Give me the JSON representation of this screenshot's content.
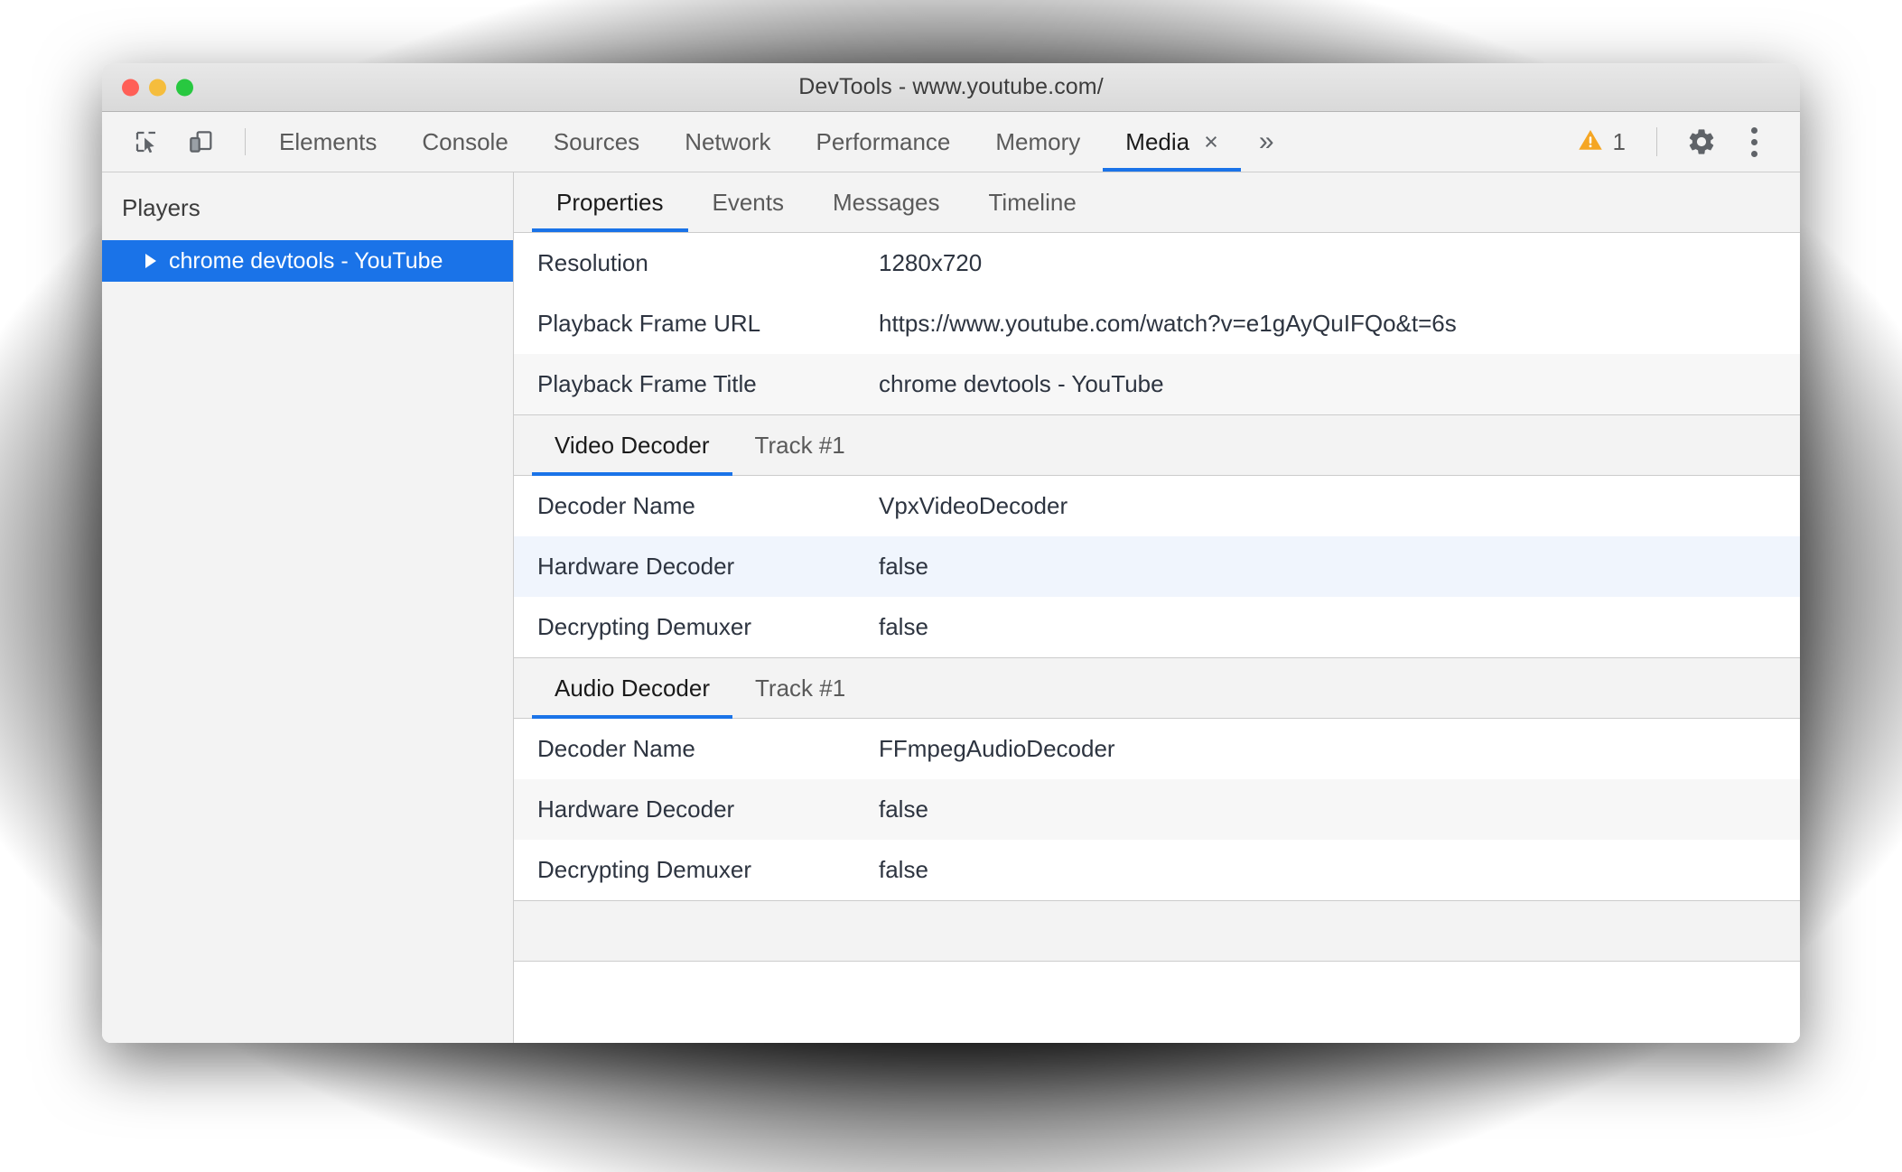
{
  "window": {
    "title": "DevTools - www.youtube.com/",
    "traffic_lights": [
      "close-red",
      "minimize-yellow",
      "zoom-green"
    ]
  },
  "toolbar": {
    "inspect_icon": "inspect-element-icon",
    "device_icon": "device-toolbar-icon",
    "tabs": [
      {
        "label": "Elements",
        "active": false,
        "closable": false
      },
      {
        "label": "Console",
        "active": false,
        "closable": false
      },
      {
        "label": "Sources",
        "active": false,
        "closable": false
      },
      {
        "label": "Network",
        "active": false,
        "closable": false
      },
      {
        "label": "Performance",
        "active": false,
        "closable": false
      },
      {
        "label": "Memory",
        "active": false,
        "closable": false
      },
      {
        "label": "Media",
        "active": true,
        "closable": true
      }
    ],
    "close_glyph": "×",
    "overflow_glyph": "»",
    "warning_count": "1",
    "warning_icon": "warning-triangle-icon",
    "settings_icon": "gear-icon",
    "more_icon": "kebab-menu-icon",
    "accent_color": "#1a73e8",
    "warning_color": "#f5a623"
  },
  "sidebar": {
    "title": "Players",
    "players": [
      {
        "label": "chrome devtools - YouTube",
        "selected": true,
        "expand_glyph": "▶"
      }
    ]
  },
  "panel": {
    "subtabs": [
      {
        "label": "Properties",
        "active": true
      },
      {
        "label": "Events",
        "active": false
      },
      {
        "label": "Messages",
        "active": false
      },
      {
        "label": "Timeline",
        "active": false
      }
    ],
    "top_properties": [
      {
        "key": "Resolution",
        "value": "1280x720",
        "style": "plain"
      },
      {
        "key": "Playback Frame URL",
        "value": "https://www.youtube.com/watch?v=e1gAyQuIFQo&t=6s",
        "style": "plain"
      },
      {
        "key": "Playback Frame Title",
        "value": "chrome devtools - YouTube",
        "style": "alt"
      }
    ],
    "video_section": {
      "tabs": [
        {
          "label": "Video Decoder",
          "active": true
        },
        {
          "label": "Track #1",
          "active": false
        }
      ],
      "rows": [
        {
          "key": "Decoder Name",
          "value": "VpxVideoDecoder",
          "style": "plain"
        },
        {
          "key": "Hardware Decoder",
          "value": "false",
          "style": "blue"
        },
        {
          "key": "Decrypting Demuxer",
          "value": "false",
          "style": "plain"
        }
      ]
    },
    "audio_section": {
      "tabs": [
        {
          "label": "Audio Decoder",
          "active": true
        },
        {
          "label": "Track #1",
          "active": false
        }
      ],
      "rows": [
        {
          "key": "Decoder Name",
          "value": "FFmpegAudioDecoder",
          "style": "plain"
        },
        {
          "key": "Hardware Decoder",
          "value": "false",
          "style": "alt"
        },
        {
          "key": "Decrypting Demuxer",
          "value": "false",
          "style": "plain"
        }
      ]
    }
  }
}
